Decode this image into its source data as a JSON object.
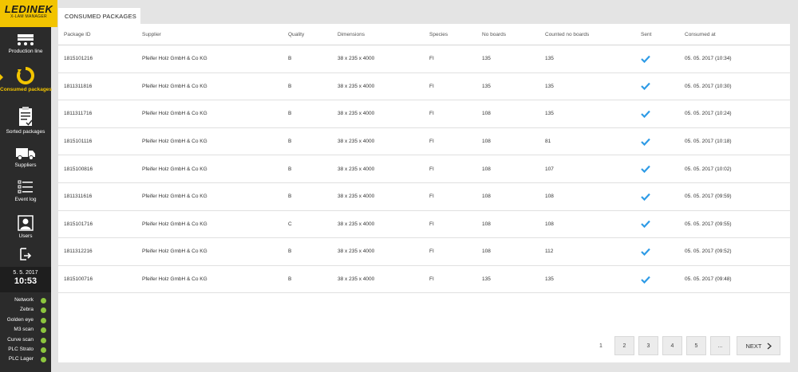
{
  "logo": {
    "main": "LEDINEK",
    "sub": "X-LAM MANAGER"
  },
  "sidebar": {
    "items": [
      {
        "label": "Production line",
        "icon": "production-line-icon"
      },
      {
        "label": "Consumed packages",
        "icon": "consumed-packages-icon",
        "active": true
      },
      {
        "label": "Sorted packages",
        "icon": "clipboard-icon"
      },
      {
        "label": "Suppliers",
        "icon": "truck-icon"
      },
      {
        "label": "Event log",
        "icon": "list-icon"
      },
      {
        "label": "Users",
        "icon": "user-icon"
      }
    ],
    "logout_icon": "logout-icon",
    "date": "5. 5. 2017",
    "time": "10:53",
    "status": [
      {
        "label": "Network",
        "color": "#8cc63e"
      },
      {
        "label": "Zebra",
        "color": "#8cc63e"
      },
      {
        "label": "Golden eye",
        "color": "#8cc63e"
      },
      {
        "label": "M3 scan",
        "color": "#8cc63e"
      },
      {
        "label": "Curve scan",
        "color": "#8cc63e"
      },
      {
        "label": "PLC Strato",
        "color": "#8cc63e"
      },
      {
        "label": "PLC Lager",
        "color": "#8cc63e"
      }
    ]
  },
  "tab": {
    "title": "CONSUMED PACKAGES"
  },
  "table": {
    "columns": [
      "Package ID",
      "Supplier",
      "Quality",
      "Dimensions",
      "Species",
      "No boards",
      "Counted no boards",
      "Sent",
      "Consumed at"
    ],
    "rows": [
      [
        "1815101216",
        "Pfeifer Holz GmbH & Co KG",
        "B",
        "38 x 235 x 4000",
        "FI",
        "135",
        "135",
        "check",
        "05. 05. 2017 (10:34)"
      ],
      [
        "1811311816",
        "Pfeifer Holz GmbH & Co KG",
        "B",
        "38 x 235 x 4000",
        "FI",
        "135",
        "135",
        "check",
        "05. 05. 2017 (10:30)"
      ],
      [
        "1811311716",
        "Pfeifer Holz GmbH & Co KG",
        "B",
        "38 x 235 x 4000",
        "FI",
        "108",
        "135",
        "check",
        "05. 05. 2017 (10:24)"
      ],
      [
        "1815101116",
        "Pfeifer Holz GmbH & Co KG",
        "B",
        "38 x 235 x 4000",
        "FI",
        "108",
        "81",
        "check",
        "05. 05. 2017 (10:18)"
      ],
      [
        "1815100816",
        "Pfeifer Holz GmbH & Co KG",
        "B",
        "38 x 235 x 4000",
        "FI",
        "108",
        "107",
        "check",
        "05. 05. 2017 (10:02)"
      ],
      [
        "1811311616",
        "Pfeifer Holz GmbH & Co KG",
        "B",
        "38 x 235 x 4000",
        "FI",
        "108",
        "108",
        "check",
        "05. 05. 2017 (09:59)"
      ],
      [
        "1815101716",
        "Pfeifer Holz GmbH & Co KG",
        "C",
        "38 x 235 x 4000",
        "FI",
        "108",
        "108",
        "check",
        "05. 05. 2017 (09:55)"
      ],
      [
        "1811312216",
        "Pfeifer Holz GmbH & Co KG",
        "B",
        "38 x 235 x 4000",
        "FI",
        "108",
        "112",
        "check",
        "05. 05. 2017 (09:52)"
      ],
      [
        "1815100716",
        "Pfeifer Holz GmbH & Co KG",
        "B",
        "38 x 235 x 4000",
        "FI",
        "135",
        "135",
        "check",
        "05. 05. 2017 (09:48)"
      ]
    ],
    "check_color": "#2e9be6"
  },
  "pagination": {
    "current": "1",
    "pages": [
      "2",
      "3",
      "4",
      "5",
      "..."
    ],
    "next_label": "NEXT"
  }
}
